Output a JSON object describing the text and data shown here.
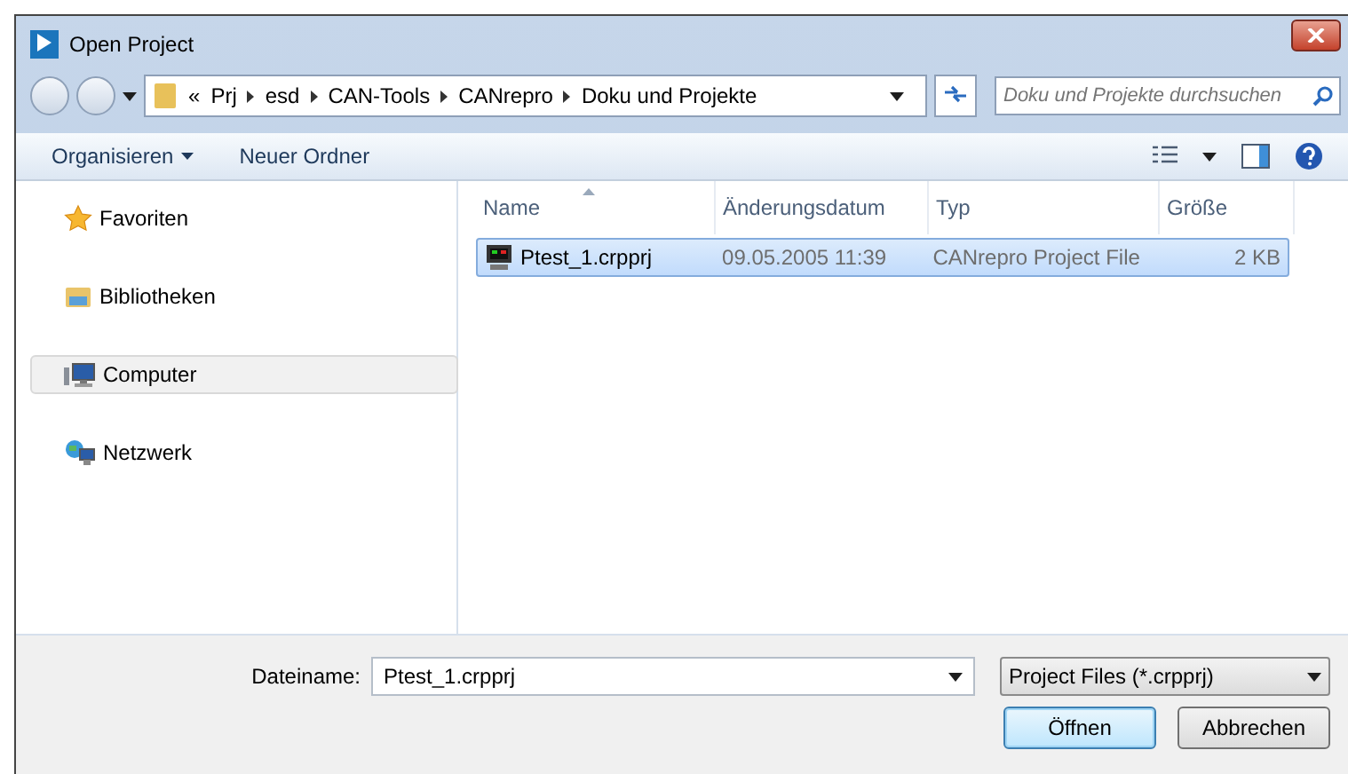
{
  "window": {
    "title": "Open Project"
  },
  "breadcrumb": {
    "overflow": "«",
    "segments": [
      "Prj",
      "esd",
      "CAN-Tools",
      "CANrepro",
      "Doku und Projekte"
    ]
  },
  "search": {
    "placeholder": "Doku und Projekte durchsuchen"
  },
  "toolbar": {
    "buttons": [
      {
        "label": "Organisieren",
        "dropdown": true
      },
      {
        "label": "Neuer Ordner",
        "dropdown": false
      }
    ]
  },
  "sidebar": {
    "items": [
      {
        "label": "Favoriten",
        "kind": "star",
        "selected": false
      },
      {
        "label": "Bibliotheken",
        "kind": "library",
        "selected": false
      },
      {
        "label": "Computer",
        "kind": "computer",
        "selected": true
      },
      {
        "label": "Netzwerk",
        "kind": "network",
        "selected": false
      }
    ]
  },
  "table": {
    "columns": [
      "Name",
      "Änderungsdatum",
      "Typ",
      "Größe"
    ],
    "rows": [
      {
        "cells": [
          "Ptest_1.crpprj",
          "09.05.2005 11:39",
          "CANrepro Project File",
          "2 KB"
        ],
        "selected": true
      }
    ]
  },
  "filename": {
    "label": "Dateiname:",
    "value": "Ptest_1.crpprj"
  },
  "filter": {
    "value": "Project Files (*.crpprj)"
  },
  "buttons": [
    {
      "label": "Öffnen",
      "default": true
    },
    {
      "label": "Abbrechen",
      "default": false
    }
  ]
}
